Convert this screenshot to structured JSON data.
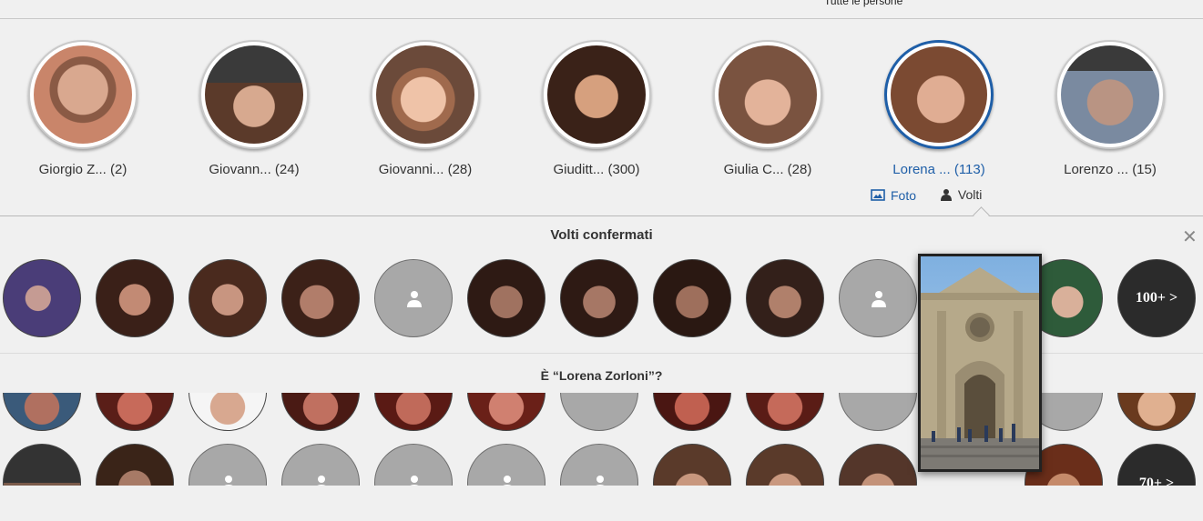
{
  "header": {
    "title": "Tutte le persone"
  },
  "people": [
    {
      "name": "Giorgio Z...",
      "count": "(2)",
      "selected": false
    },
    {
      "name": "Giovann...",
      "count": "(24)",
      "selected": false
    },
    {
      "name": "Giovanni...",
      "count": "(28)",
      "selected": false
    },
    {
      "name": "Giuditt...",
      "count": "(300)",
      "selected": false
    },
    {
      "name": "Giulia C...",
      "count": "(28)",
      "selected": false
    },
    {
      "name": "Lorena ...",
      "count": "(113)",
      "selected": true
    },
    {
      "name": "Lorenzo ...",
      "count": "(15)",
      "selected": false
    }
  ],
  "tabs": {
    "foto": "Foto",
    "volti": "Volti"
  },
  "confirmed": {
    "title": "Volti confermati",
    "more": "100+ >"
  },
  "suggested": {
    "title": "È “Lorena Zorloni”?",
    "more": "70+ >"
  },
  "colors": {
    "accent": "#1f5fa8",
    "placeholder": "#a8a8a8"
  }
}
